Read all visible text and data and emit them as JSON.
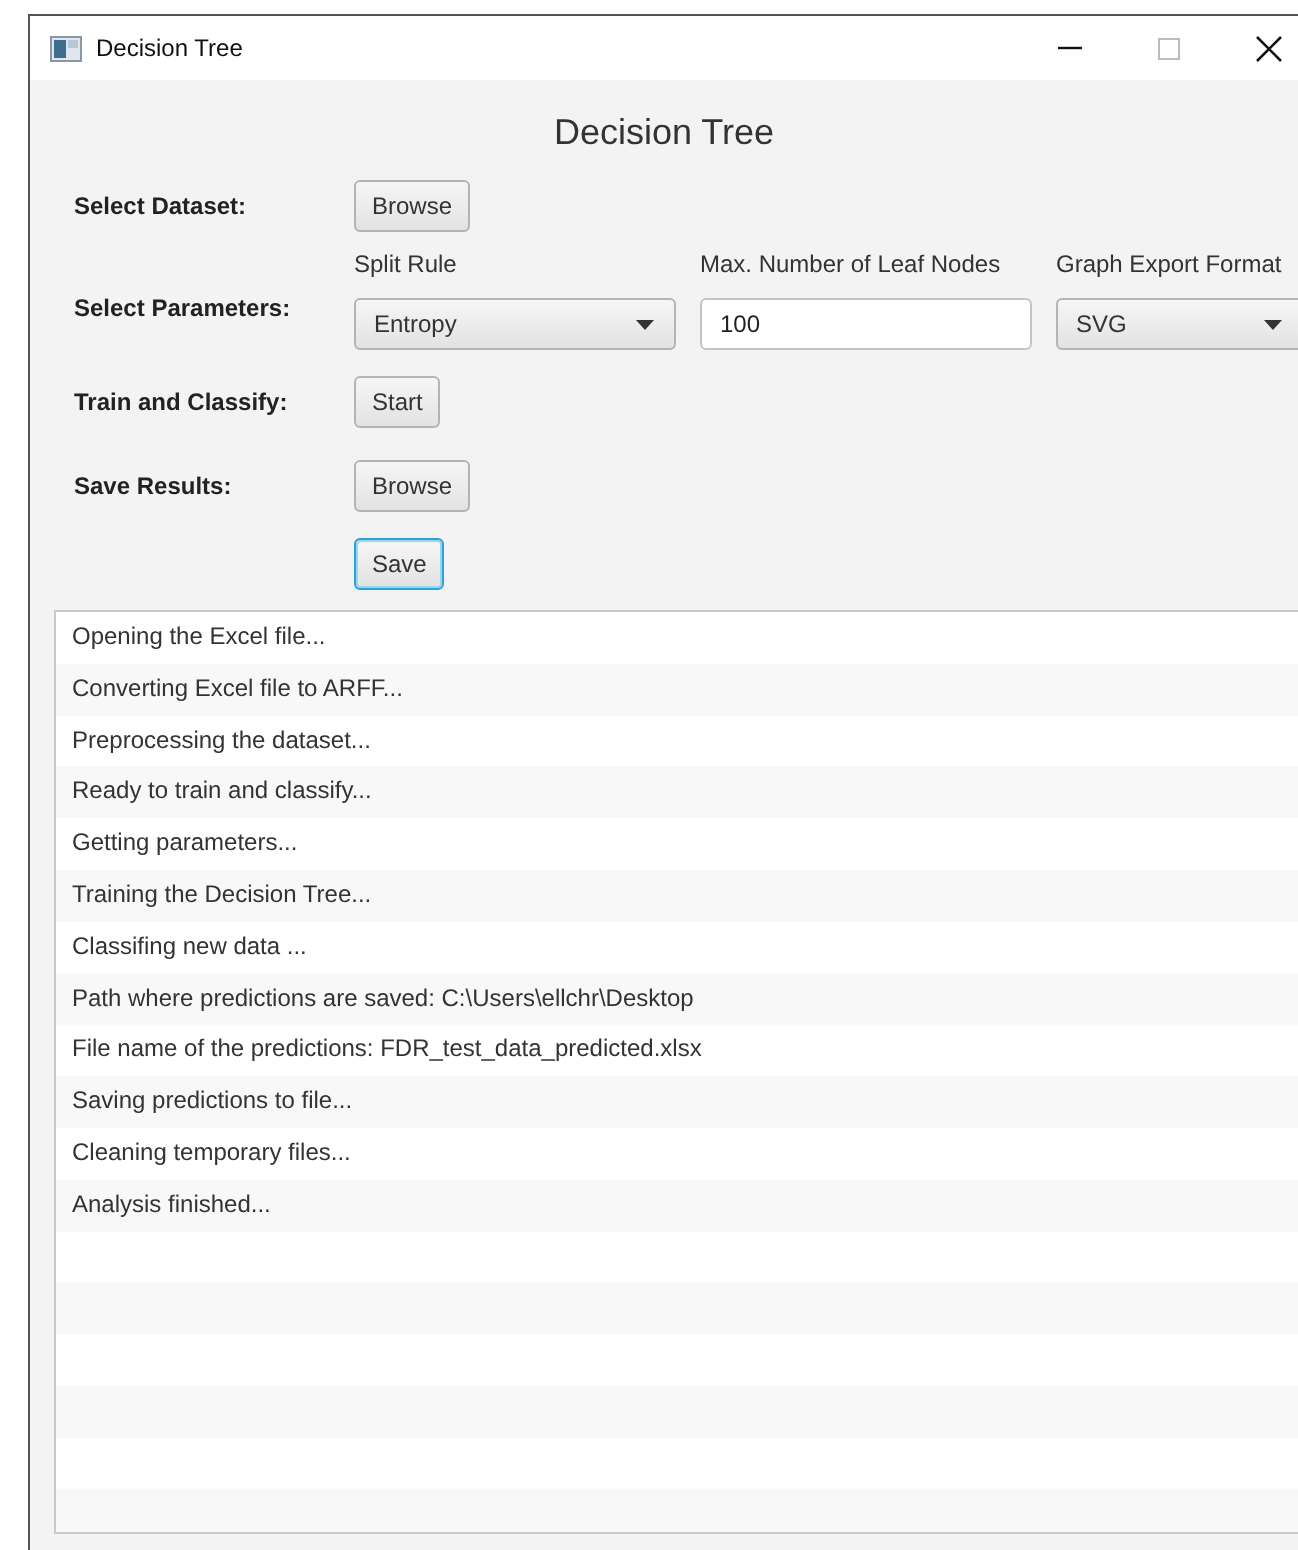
{
  "window": {
    "title": "Decision Tree"
  },
  "heading": "Decision Tree",
  "dataset": {
    "label": "Select Dataset:",
    "button": "Browse"
  },
  "parameters": {
    "label": "Select Parameters:",
    "split_rule": {
      "label": "Split Rule",
      "value": "Entropy"
    },
    "max_leaf_nodes": {
      "label": "Max. Number of Leaf Nodes",
      "value": "100"
    },
    "export_format": {
      "label": "Graph Export Format",
      "value": "SVG"
    }
  },
  "train": {
    "label": "Train and Classify:",
    "button": "Start"
  },
  "save_results": {
    "label": "Save Results:",
    "button": "Browse"
  },
  "save_button": {
    "label": "Save",
    "focused": true
  },
  "log": [
    "Opening the Excel file...",
    "Converting Excel file to ARFF...",
    "Preprocessing the dataset...",
    "Ready to train and classify...",
    "Getting parameters...",
    "Training the Decision Tree...",
    "Classifing new data ...",
    "Path where predictions are saved: C:\\Users\\ellchr\\Desktop",
    "File name of the predictions: FDR_test_data_predicted.xlsx",
    "Saving predictions to file...",
    "Cleaning temporary files...",
    "Analysis finished..."
  ]
}
